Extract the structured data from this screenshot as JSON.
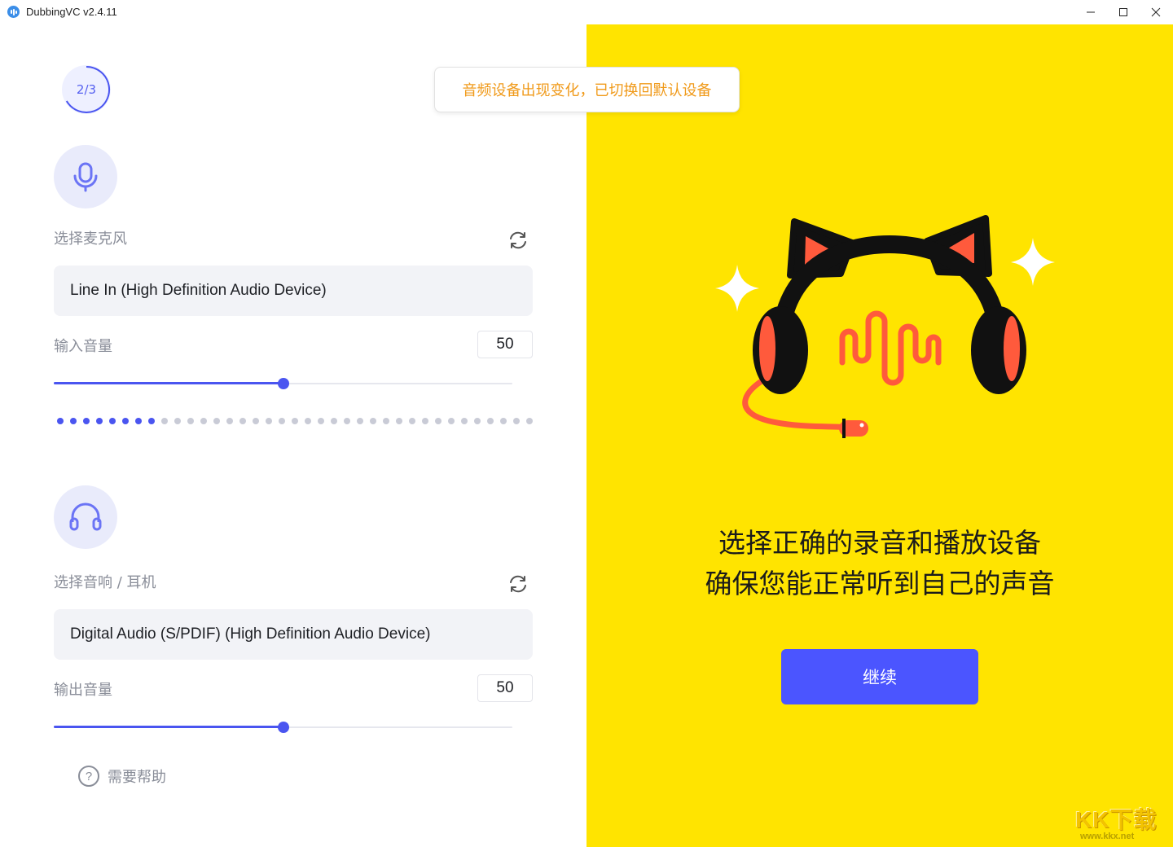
{
  "window": {
    "title": "DubbingVC v2.4.11",
    "minimize_icon": "minimize-icon",
    "maximize_icon": "maximize-icon",
    "close_icon": "close-icon"
  },
  "step": {
    "label": "2/3",
    "current": 2,
    "total": 3
  },
  "toast": {
    "text": "音频设备出现变化，已切换回默认设备",
    "color": "#f09a1a"
  },
  "microphone": {
    "icon": "microphone-icon",
    "label": "选择麦克风",
    "refresh_icon": "refresh-icon",
    "device": "Line In (High Definition Audio Device)",
    "volume_label": "输入音量",
    "volume_value": "50",
    "volume": 50,
    "level_meter": {
      "total_dots": 37,
      "active_dots": 8
    }
  },
  "speaker": {
    "icon": "headphones-icon",
    "label": "选择音响 / 耳机",
    "refresh_icon": "refresh-icon",
    "device": "Digital Audio (S/PDIF) (High Definition Audio Device)",
    "volume_label": "输出音量",
    "volume_value": "50",
    "volume": 50
  },
  "help": {
    "icon": "help-icon",
    "label": "需要帮助"
  },
  "promo": {
    "illustration": "cat-ear-headphones-illustration",
    "line1": "选择正确的录音和播放设备",
    "line2": "确保您能正常听到自己的声音",
    "continue_label": "继续"
  },
  "watermark": {
    "logo": "KK下载",
    "url": "www.kkx.net"
  },
  "colors": {
    "accent": "#4a55f0",
    "button": "#4b55ff",
    "yellow_panel": "#ffe400",
    "meter_inactive": "#c9cbd6",
    "coral": "#ff5a3c"
  }
}
